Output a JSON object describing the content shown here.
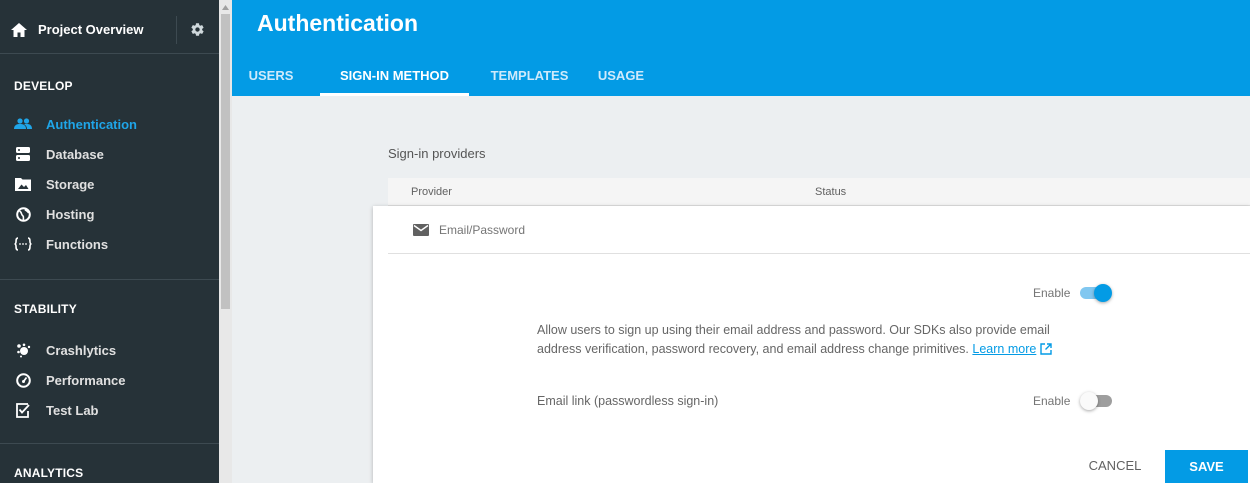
{
  "sidebar": {
    "project_label": "Project Overview",
    "sections": {
      "develop": "DEVELOP",
      "stability": "STABILITY",
      "analytics": "ANALYTICS"
    },
    "develop_items": [
      {
        "label": "Authentication",
        "icon": "people-icon",
        "active": true
      },
      {
        "label": "Database",
        "icon": "database-icon"
      },
      {
        "label": "Storage",
        "icon": "image-icon"
      },
      {
        "label": "Hosting",
        "icon": "globe-icon"
      },
      {
        "label": "Functions",
        "icon": "functions-icon"
      }
    ],
    "stability_items": [
      {
        "label": "Crashlytics",
        "icon": "crashlytics-icon"
      },
      {
        "label": "Performance",
        "icon": "speedometer-icon"
      },
      {
        "label": "Test Lab",
        "icon": "checklist-icon"
      }
    ]
  },
  "header": {
    "title": "Authentication",
    "tabs": [
      {
        "label": "USERS"
      },
      {
        "label": "SIGN-IN METHOD",
        "active": true
      },
      {
        "label": "TEMPLATES"
      },
      {
        "label": "USAGE"
      }
    ]
  },
  "main": {
    "section_label": "Sign-in providers",
    "table_headers": {
      "provider": "Provider",
      "status": "Status"
    },
    "provider": {
      "name": "Email/Password",
      "icon": "envelope-icon",
      "enable_label": "Enable",
      "enabled": true,
      "description": "Allow users to sign up using their email address and password. Our SDKs also provide email address verification, password recovery, and email address change primitives.",
      "learn_more": "Learn more",
      "email_link_label": "Email link (passwordless sign-in)",
      "email_link_enable_label": "Enable",
      "email_link_enabled": false
    },
    "buttons": {
      "cancel": "CANCEL",
      "save": "SAVE"
    }
  },
  "colors": {
    "primary": "#039be5",
    "sidebar_bg": "#263238",
    "active_nav": "#1fa5e8",
    "page_bg": "#eceff1"
  }
}
